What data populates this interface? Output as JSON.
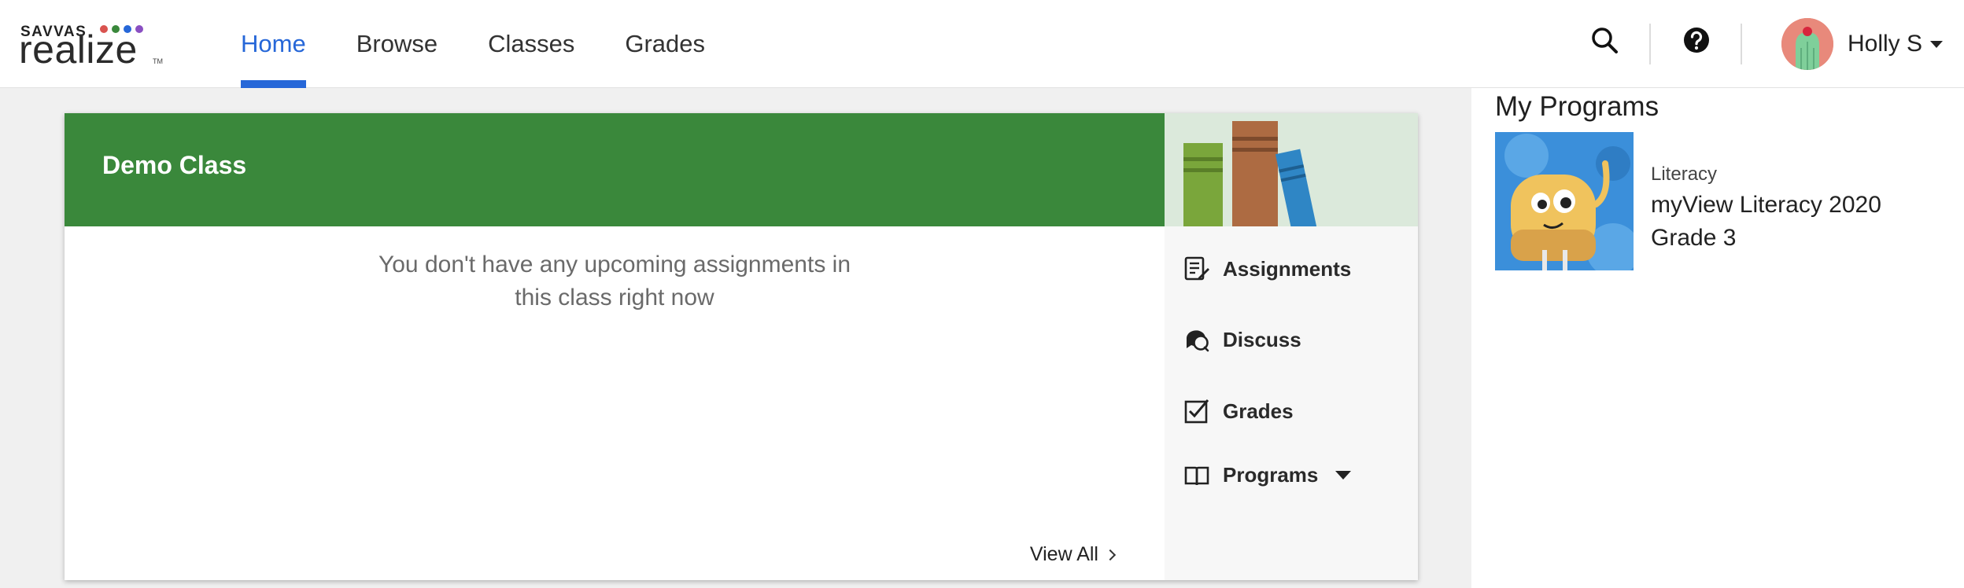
{
  "brand": {
    "small": "SAVVAS",
    "big": "realize",
    "tm": "TM",
    "dot_colors": [
      "#d9534f",
      "#3a883b",
      "#2667d8",
      "#8a4fc2",
      "#2aa6c9"
    ]
  },
  "nav": {
    "items": [
      {
        "label": "Home",
        "active": true
      },
      {
        "label": "Browse",
        "active": false
      },
      {
        "label": "Classes",
        "active": false
      },
      {
        "label": "Grades",
        "active": false
      }
    ]
  },
  "header": {
    "search_icon": "search-icon",
    "help_icon": "help-icon",
    "user_name": "Holly S"
  },
  "class_card": {
    "title": "Demo Class",
    "header_color": "#3a883b",
    "empty_line1": "You don't have any upcoming assignments in",
    "empty_line2": "this class right now",
    "view_all": "View All",
    "side_items": [
      {
        "label": "Assignments",
        "icon": "assignments-icon"
      },
      {
        "label": "Discuss",
        "icon": "discuss-icon"
      },
      {
        "label": "Grades",
        "icon": "grades-icon"
      },
      {
        "label": "Programs",
        "icon": "book-icon"
      }
    ]
  },
  "my_programs": {
    "title": "My Programs",
    "items": [
      {
        "category": "Literacy",
        "name": "myView Literacy 2020 Grade 3"
      }
    ]
  },
  "colors": {
    "accent": "#2667d8",
    "class_green": "#3a883b"
  }
}
